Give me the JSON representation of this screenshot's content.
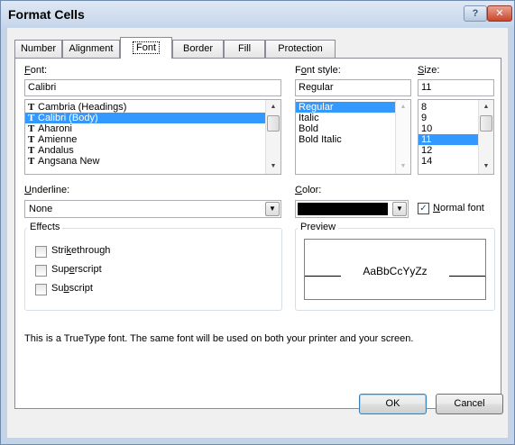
{
  "window": {
    "title": "Format Cells",
    "help_glyph": "?",
    "close_glyph": "✕"
  },
  "tabs": [
    {
      "label": "Number"
    },
    {
      "label": "Alignment"
    },
    {
      "label": "Font"
    },
    {
      "label": "Border"
    },
    {
      "label": "Fill"
    },
    {
      "label": "Protection"
    }
  ],
  "font": {
    "label_key": "F",
    "label_rest": "ont:",
    "value": "Calibri",
    "items": [
      "Cambria (Headings)",
      "Calibri (Body)",
      "Aharoni",
      "Amienne",
      "Andalus",
      "Angsana New"
    ],
    "selected_index": 1,
    "tt_glyph": "T"
  },
  "font_style": {
    "label_pre": "F",
    "label_key": "o",
    "label_rest": "nt style:",
    "value": "Regular",
    "items": [
      "Regular",
      "Italic",
      "Bold",
      "Bold Italic"
    ],
    "selected_index": 0
  },
  "size": {
    "label_key": "S",
    "label_rest": "ize:",
    "value": "11",
    "items": [
      "8",
      "9",
      "10",
      "11",
      "12",
      "14"
    ],
    "selected_index": 3
  },
  "underline": {
    "label_key": "U",
    "label_rest": "nderline:",
    "value": "None"
  },
  "color": {
    "label_key": "C",
    "label_rest": "olor:",
    "swatch": "#000000"
  },
  "normal_font": {
    "label_key": "N",
    "label_rest": "ormal font",
    "checked": true,
    "check_glyph": "✓"
  },
  "effects": {
    "label": "Effects",
    "strikethrough": {
      "pre": "Stri",
      "key": "k",
      "post": "ethrough"
    },
    "superscript": {
      "pre": "Sup",
      "key": "e",
      "post": "rscript"
    },
    "subscript": {
      "pre": "Su",
      "key": "b",
      "post": "script"
    }
  },
  "preview": {
    "label": "Preview",
    "sample": "AaBbCcYyZz"
  },
  "info_text": "This is a TrueType font.  The same font will be used on both your printer and your screen.",
  "buttons": {
    "ok": "OK",
    "cancel": "Cancel"
  },
  "scroll": {
    "up": "▲",
    "down": "▼",
    "combo": "▼"
  }
}
